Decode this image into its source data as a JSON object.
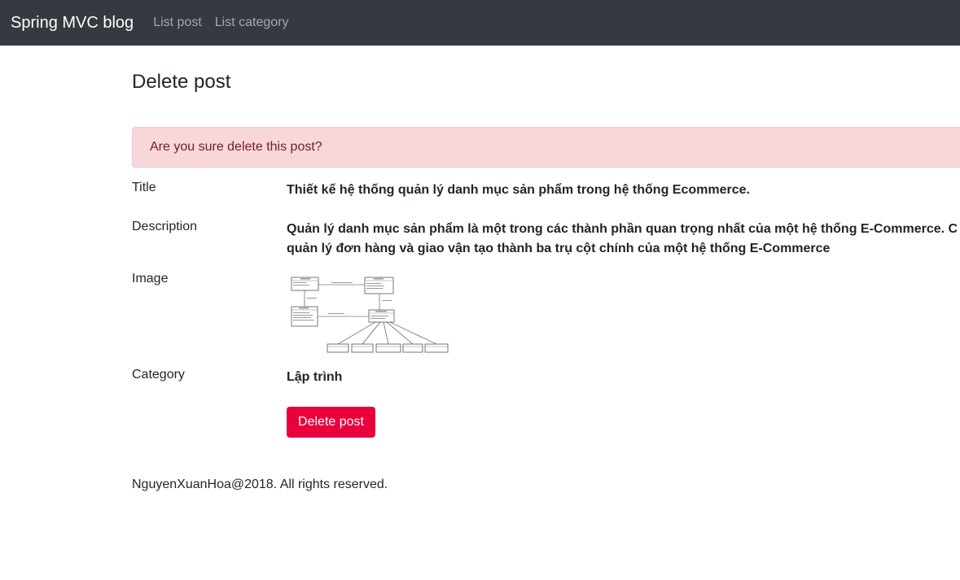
{
  "nav": {
    "brand": "Spring MVC blog",
    "links": [
      "List post",
      "List category"
    ]
  },
  "page": {
    "title": "Delete post",
    "alert": "Are you sure delete this post?"
  },
  "post": {
    "title_label": "Title",
    "title_value": "Thiết kế hệ thống quản lý danh mục sản phẩm trong hệ thống Ecommerce.",
    "description_label": "Description",
    "description_line1": "Quản lý danh mục sản phẩm là một trong các thành phần quan trọng nhất của một hệ thống E-Commerce. C",
    "description_line2": "quản lý đơn hàng và giao vận tạo thành ba trụ cột chính của một hệ thống E-Commerce",
    "image_label": "Image",
    "category_label": "Category",
    "category_value": "Lập trình",
    "delete_button": "Delete post"
  },
  "footer": {
    "text": "NguyenXuanHoa@2018. All rights reserved."
  },
  "colors": {
    "navbar": "#343a40",
    "alert_bg": "#f8d7da",
    "alert_text": "#721c24",
    "danger": "#e9003c"
  }
}
